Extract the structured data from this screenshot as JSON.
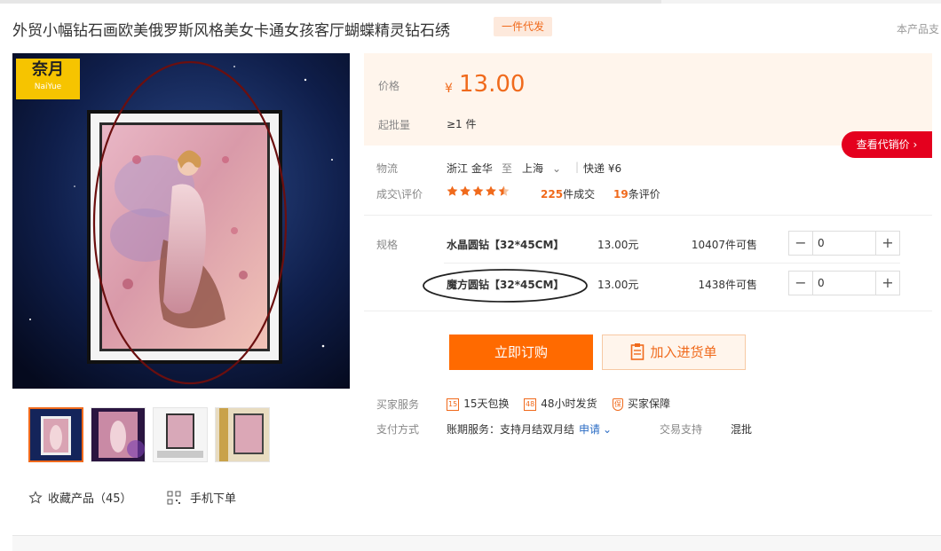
{
  "header": {
    "title": "外贸小幅钻石画欧美俄罗斯风格美女卡通女孩客厅蝴蝶精灵钻石绣",
    "badge": "一件代发",
    "right_link": "本产品支"
  },
  "gallery": {
    "logo_main": "奈月",
    "logo_sub": "NaiYue",
    "thumbnail_count": 4
  },
  "actions": {
    "favorite": "收藏产品（45）",
    "mobile_order": "手机下单"
  },
  "price": {
    "label": "价格",
    "currency": "¥",
    "value": "13.00",
    "moq_label": "起批量",
    "moq_value": "≥1 件",
    "agent_price_button": "查看代销价"
  },
  "logistics": {
    "label": "物流",
    "from": "浙江 金华",
    "to_word": "至",
    "to": "上海",
    "method": "快递 ¥6"
  },
  "trade": {
    "label": "成交\\评价",
    "rating_stars": 4.5,
    "deals_count": "225",
    "deals_suffix": "件成交",
    "reviews_count": "19",
    "reviews_suffix": "条评价"
  },
  "specs": {
    "label": "规格",
    "items": [
      {
        "name": "水晶圆钻【32*45CM】",
        "price": "13.00元",
        "stock": "10407件可售",
        "quantity": "0"
      },
      {
        "name": "魔方圆钻【32*45CM】",
        "price": "13.00元",
        "stock": "1438件可售",
        "quantity": "0"
      }
    ]
  },
  "buttons": {
    "buy_now": "立即订购",
    "add_to_list": "加入进货单"
  },
  "services": {
    "label": "买家服务",
    "items": [
      {
        "icon_text": "15",
        "label": "15天包换"
      },
      {
        "icon_text": "48",
        "label": "48小时发货"
      },
      {
        "icon_text": "保",
        "label": "买家保障"
      }
    ]
  },
  "payment": {
    "label": "支付方式",
    "text": "账期服务：支持月结双月结",
    "apply_link": "申请",
    "trade_support_label": "交易支持",
    "trade_support_value": "混批"
  },
  "colors": {
    "accent": "#ff6a00",
    "price_bg": "#fff5ec",
    "agent_red": "#e4001e",
    "annotation": "#6b0f0f"
  }
}
